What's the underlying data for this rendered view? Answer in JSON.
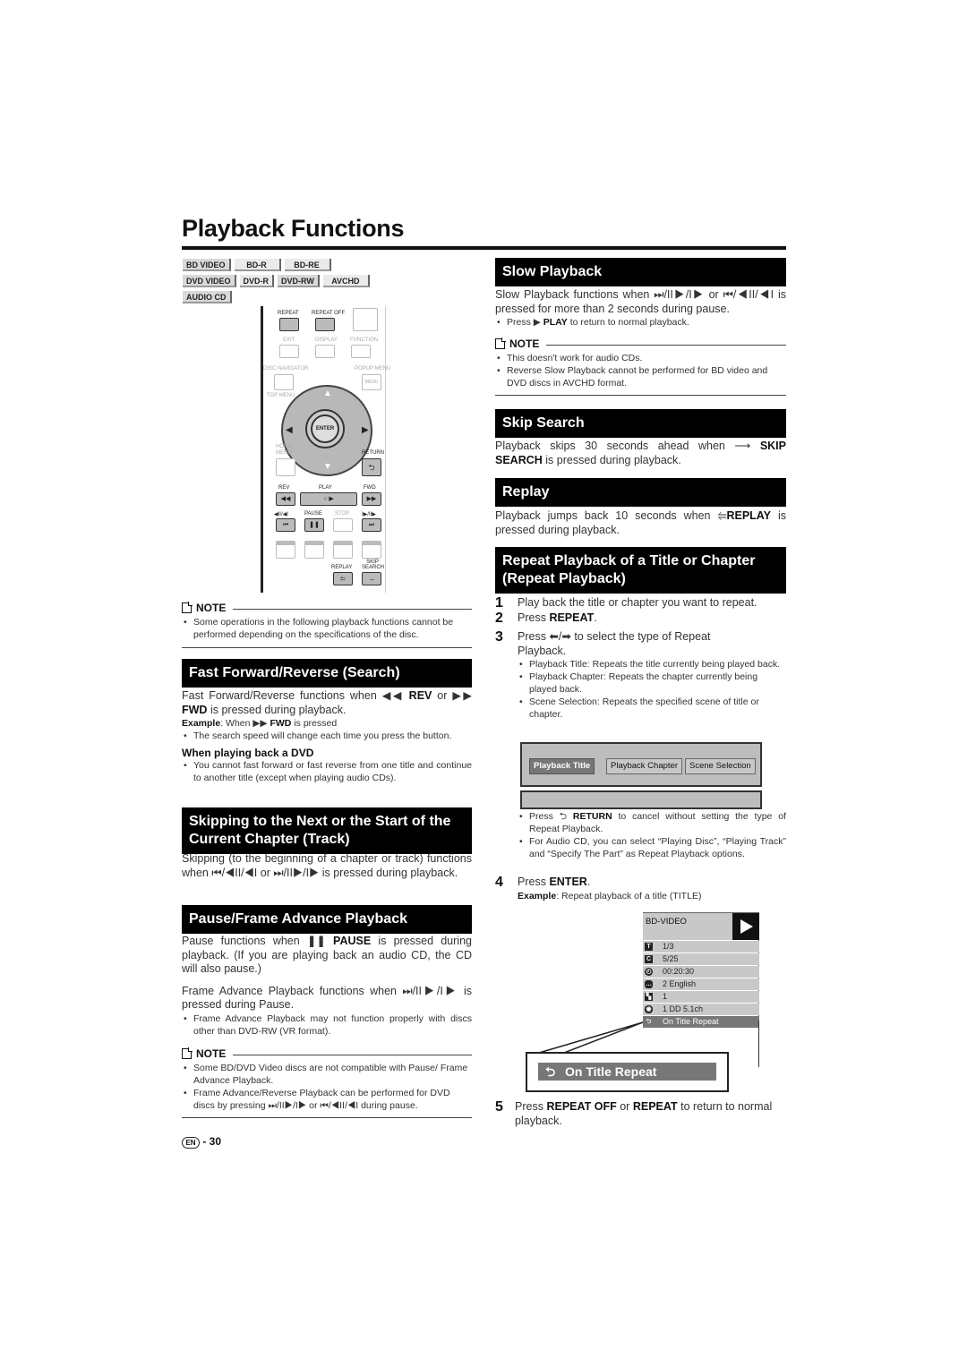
{
  "page": {
    "title": "Playback Functions",
    "page_label": "EN",
    "page_number": "- 30"
  },
  "badges": {
    "row1": [
      "BD VIDEO",
      "BD-R",
      "BD-RE"
    ],
    "row2": [
      "DVD VIDEO",
      "DVD-R",
      "DVD-RW",
      "AVCHD"
    ],
    "row3": [
      "AUDIO CD"
    ]
  },
  "remote": {
    "repeat": "REPEAT",
    "repeat_off": "REPEAT OFF",
    "exit": "EXIT",
    "display": "DISPLAY",
    "function": "FUNCTION",
    "disc_navigator": "DISC NAVIGATOR",
    "popup_menu": "POPUP MENU",
    "menu": "MENU",
    "top_menu": "TOP MENU",
    "enter": "ENTER",
    "home_menu": "HOME MENU",
    "return": "RETURN",
    "rev": "REV",
    "play": "PLAY",
    "fwd": "FWD",
    "skip_back": "◀II/◀I",
    "pause": "PAUSE",
    "stop": "STOP",
    "skip_fwd": "I▶/II▶",
    "replay": "REPLAY",
    "skip_search": "SKIP SEARCH"
  },
  "left": {
    "note1": {
      "heading": "NOTE",
      "bullets": [
        "Some operations in the following playback functions cannot be performed depending on the specifications of the disc."
      ]
    },
    "ff": {
      "heading": "Fast Forward/Reverse (Search)",
      "text1": "Fast Forward/Reverse functions when",
      "rev": "REV",
      "or": "or",
      "fwd": "FWD",
      "text2": "is pressed during playback.",
      "example_label": "Example",
      "example_text": ": When",
      "example_fwd": "FWD",
      "example_tail": "is pressed",
      "bullet": "The search speed will change each time you press the button.",
      "subheading": "When playing back a DVD",
      "sub_bullet": "You cannot fast forward or fast reverse from one title and continue to another title (except when playing audio CDs)."
    },
    "skip": {
      "heading": "Skipping to the Next or the Start of the Current Chapter (Track)",
      "text": "Skipping (to the beginning of a chapter or track) functions when ⏮/◀II/◀I or ⏭/II▶/I▶ is pressed during playback."
    },
    "pause": {
      "heading": "Pause/Frame Advance Playback",
      "text1": "Pause functions when",
      "pause_label": "PAUSE",
      "text2": "is pressed during playback. (If you are playing back an audio CD, the CD will also pause.)",
      "text3": "Frame Advance Playback functions when ⏭/II▶/I▶ is pressed during Pause.",
      "bullet": "Frame Advance Playback may not function properly with discs other than DVD-RW (VR format)."
    },
    "note2": {
      "heading": "NOTE",
      "bullets": [
        "Some BD/DVD Video discs are not compatible with Pause/ Frame Advance Playback.",
        "Frame Advance/Reverse Playback can be performed for DVD discs by pressing ⏭/II▶/I▶ or ⏮/◀II/◀I during pause."
      ]
    }
  },
  "right": {
    "slow": {
      "heading": "Slow Playback",
      "text": "Slow Playback functions when ⏭/II▶/I▶ or ⏮/◀II/◀I is pressed for more than 2 seconds during pause.",
      "bullet_pre": "Press",
      "bullet_play": "PLAY",
      "bullet_post": "to return to normal playback.",
      "note_heading": "NOTE",
      "note_bullets": [
        "This doesn't work for audio CDs.",
        "Reverse Slow Playback cannot be performed for BD video and DVD discs in AVCHD format."
      ]
    },
    "skipsearch": {
      "heading": "Skip Search",
      "text1": "Playback skips 30 seconds ahead when",
      "skip": "SKIP",
      "search": "SEARCH",
      "text2": "is pressed during playback."
    },
    "replay": {
      "heading": "Replay",
      "text1": "Playback jumps back 10 seconds when",
      "replay": "REPLAY",
      "text2": "is pressed during playback."
    },
    "repeat": {
      "heading": "Repeat Playback of a Title or Chapter (Repeat Playback)",
      "step1": "Play back the title or chapter you want to repeat.",
      "step2_pre": "Press",
      "step2_b": "REPEAT",
      "step3": "Press ⬅/➡ to select the type of Repeat Playback.",
      "step3_bullets": [
        "Playback Title: Repeats the title currently being played back.",
        "Playback Chapter: Repeats the chapter currently being played back.",
        "Scene Selection: Repeats the specified scene of title or chapter."
      ],
      "menu_options": [
        "Playback Title",
        "Playback Chapter",
        "Scene Selection"
      ],
      "menu_selected": "Playback Title",
      "after_bullet1_pre": "Press",
      "after_bullet1_b": "RETURN",
      "after_bullet1_post": "to cancel without setting the type of Repeat Playback.",
      "after_bullet2": "For Audio CD, you can select “Playing Disc”, “Playing Track” and “Specify The Part” as Repeat Playback options.",
      "step4_pre": "Press",
      "step4_b": "ENTER",
      "example_label": "Example",
      "example_text": ": Repeat playback of a title (TITLE)",
      "step5_pre": "Press",
      "step5_b1": "REPEAT OFF",
      "step5_or": "or",
      "step5_b2": "REPEAT",
      "step5_post": "to return to normal playback."
    },
    "osd": {
      "disc": "BD-VIDEO",
      "rows": [
        {
          "icon": "T",
          "value": "1/3"
        },
        {
          "icon": "C",
          "value": "5/25"
        },
        {
          "icon": "◴",
          "value": "00:20:30"
        },
        {
          "icon": "…",
          "value": "2 English"
        },
        {
          "icon": "▚",
          "value": "1"
        },
        {
          "icon": "◉",
          "value": "1  DD  5.1ch"
        },
        {
          "icon": "⮌",
          "value": "On Title Repeat"
        }
      ],
      "callout": "On Title Repeat"
    }
  }
}
